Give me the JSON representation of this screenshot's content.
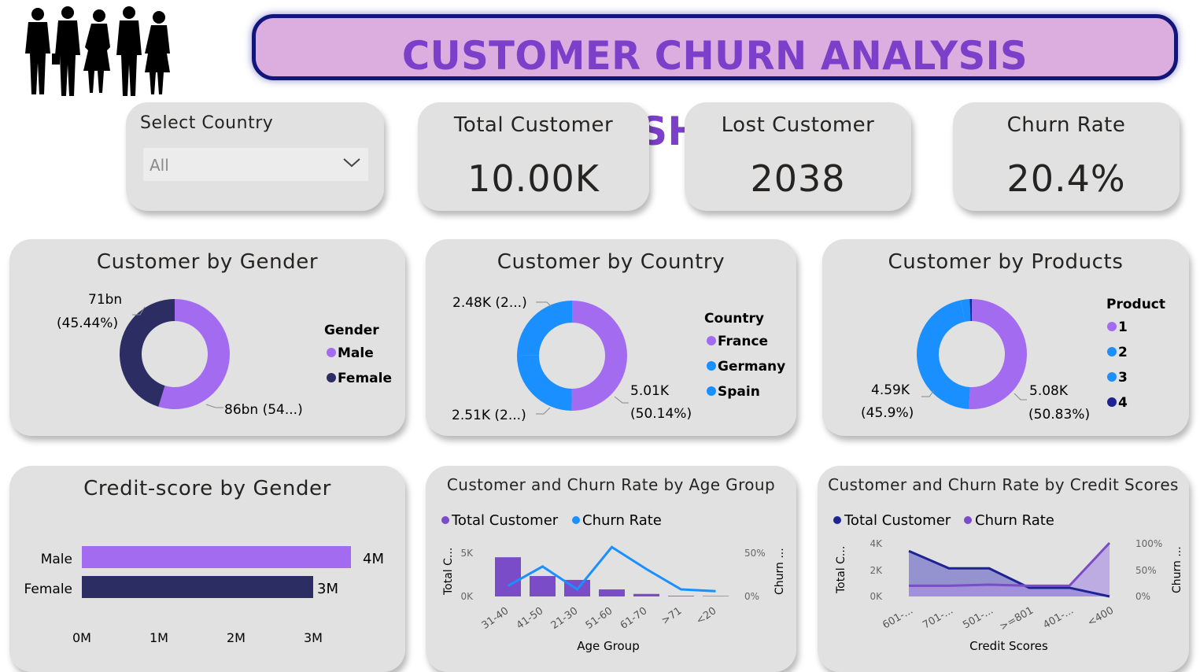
{
  "title": "CUSTOMER CHURN ANALYSIS DASHBOARD",
  "slicer": {
    "label": "Select Country",
    "value": "All"
  },
  "kpis": {
    "total": {
      "label": "Total Customer",
      "value": "10.00K"
    },
    "lost": {
      "label": "Lost Customer",
      "value": "2038"
    },
    "churn": {
      "label": "Churn Rate",
      "value": "20.4%"
    }
  },
  "colors": {
    "purple": "#a36bf0",
    "navy": "#2b2d63",
    "blue": "#1a8fff",
    "darkblue": "#1c2494",
    "darkpurple": "#7a4cc8",
    "banner_bg": "#dcaee0",
    "banner_text": "#7b3fc9"
  },
  "gender_chart": {
    "title": "Customer by Gender",
    "legend_title": "Gender",
    "legend": [
      "Male",
      "Female"
    ],
    "label_female_1": "71bn",
    "label_female_2": "(45.44%)",
    "label_male": "86bn (54...)"
  },
  "country_chart": {
    "title": "Customer by Country",
    "legend_title": "Country",
    "legend": [
      "France",
      "Germany",
      "Spain"
    ],
    "label_top": "2.48K (2...)",
    "label_bottom": "2.51K (2...)",
    "label_right_1": "5.01K",
    "label_right_2": "(50.14%)"
  },
  "products_chart": {
    "title": "Customer by Products",
    "legend_title": "Product",
    "legend": [
      "1",
      "2",
      "3",
      "4"
    ],
    "label_left_1": "4.59K",
    "label_left_2": "(45.9%)",
    "label_right_1": "5.08K",
    "label_right_2": "(50.83%)"
  },
  "credit_gender_chart": {
    "title": "Credit-score by Gender",
    "x_ticks": [
      "0M",
      "1M",
      "2M",
      "3M"
    ]
  },
  "age_chart": {
    "title": "Customer and Churn Rate by Age Group",
    "legend": [
      "Total Customer",
      "Churn Rate"
    ],
    "xlabel": "Age Group",
    "ylabel_left": "Total C...",
    "ylabel_right": "Churn ...",
    "y_left_ticks": [
      "5K",
      "0K"
    ],
    "y_right_ticks": [
      "50%",
      "0%"
    ]
  },
  "credit_chart": {
    "title": "Customer and Churn Rate by Credit Scores",
    "legend": [
      "Total Customer",
      "Churn Rate"
    ],
    "xlabel": "Credit Scores",
    "ylabel_left": "Total C...",
    "ylabel_right": "Churn ...",
    "y_left_ticks": [
      "4K",
      "2K",
      "0K"
    ],
    "y_right_ticks": [
      "100%",
      "50%",
      "0%"
    ]
  },
  "chart_data": [
    {
      "type": "pie",
      "title": "Customer by Gender",
      "categories": [
        "Male",
        "Female"
      ],
      "values": [
        86,
        71
      ],
      "percent": [
        54.56,
        45.44
      ],
      "units": "bn"
    },
    {
      "type": "pie",
      "title": "Customer by Country",
      "categories": [
        "France",
        "Germany",
        "Spain"
      ],
      "values": [
        5014,
        2509,
        2477
      ],
      "percent": [
        50.14,
        25.09,
        24.77
      ]
    },
    {
      "type": "pie",
      "title": "Customer by Products",
      "categories": [
        "1",
        "2",
        "3",
        "4"
      ],
      "values": [
        5084,
        4590,
        266,
        60
      ],
      "percent": [
        50.84,
        45.9,
        2.66,
        0.6
      ]
    },
    {
      "type": "bar",
      "title": "Credit-score by Gender",
      "categories": [
        "Male",
        "Female"
      ],
      "values": [
        4.5,
        3.0
      ],
      "value_labels": [
        "4M",
        "3M"
      ],
      "xlim": [
        0,
        3.5
      ]
    },
    {
      "type": "bar",
      "title": "Customer and Churn Rate by Age Group",
      "categories": [
        "31-40",
        "41-50",
        "21-30",
        "51-60",
        "61-70",
        ">71",
        "<20"
      ],
      "series": [
        {
          "name": "Total Customer",
          "values": [
            4450,
            2320,
            1880,
            800,
            290,
            70,
            50
          ]
        },
        {
          "name": "Churn Rate",
          "values": [
            12,
            34,
            8,
            56,
            31,
            8,
            6
          ]
        }
      ],
      "ylim_left": [
        0,
        5000
      ],
      "ylim_right": [
        0,
        50
      ]
    },
    {
      "type": "area",
      "title": "Customer and Churn Rate by Credit Scores",
      "categories": [
        "601-...",
        "701-...",
        "501-...",
        ">=801",
        "401-...",
        "<400"
      ],
      "series": [
        {
          "name": "Total Customer",
          "values": [
            3400,
            2100,
            2100,
            650,
            650,
            0
          ]
        },
        {
          "name": "Churn Rate",
          "values": [
            20,
            20,
            22,
            20,
            20,
            100
          ]
        }
      ],
      "ylim_left": [
        0,
        4000
      ],
      "ylim_right": [
        0,
        100
      ]
    }
  ]
}
